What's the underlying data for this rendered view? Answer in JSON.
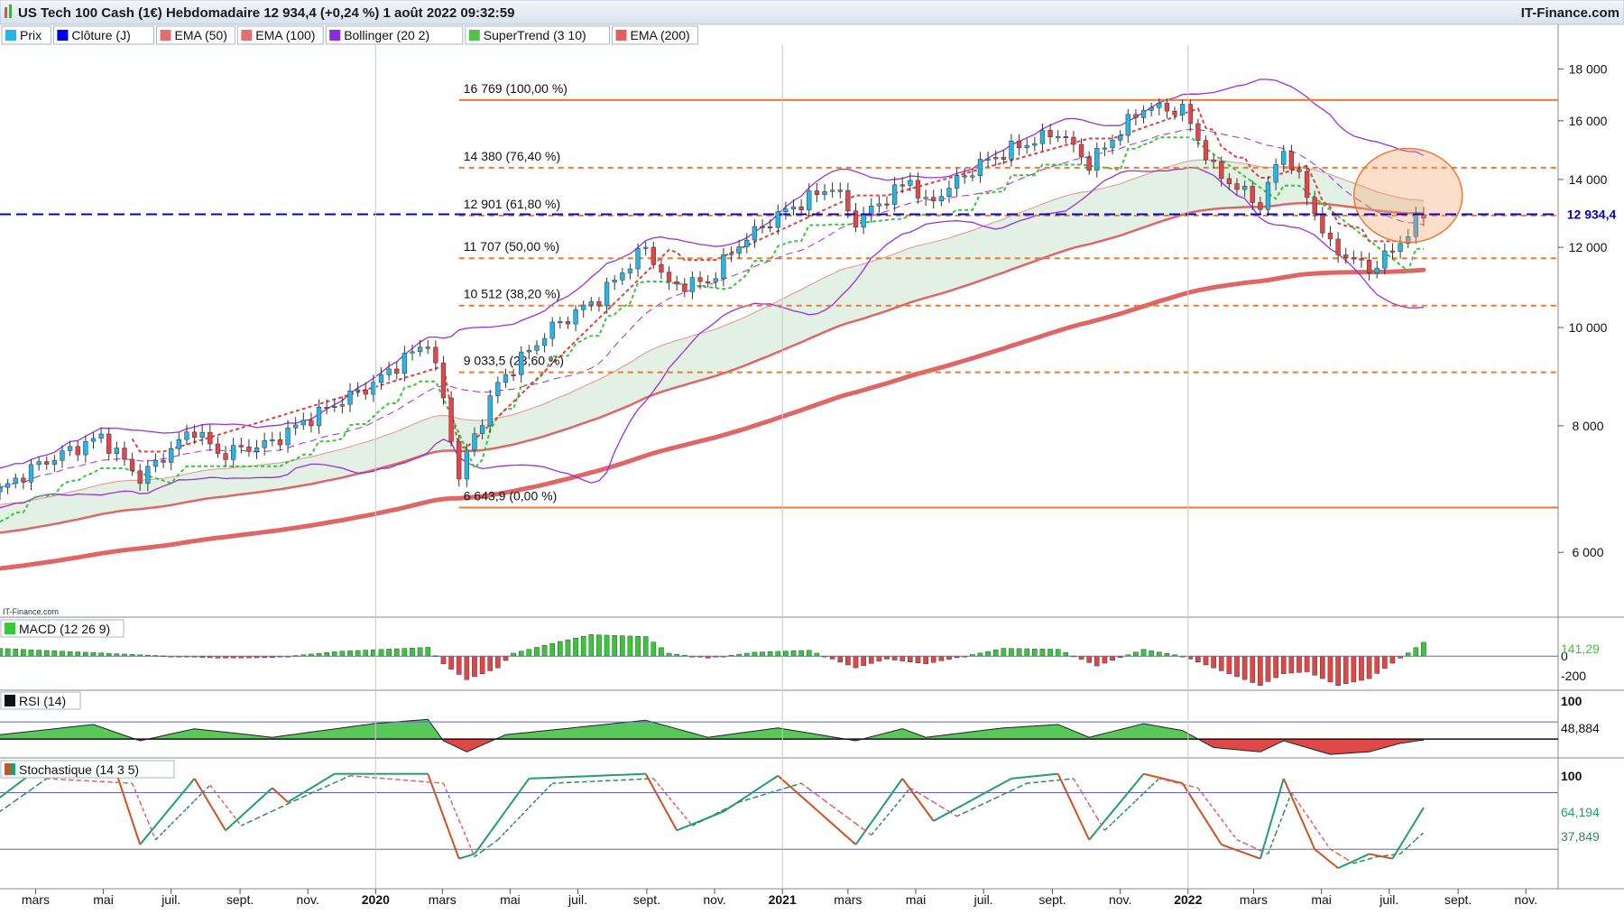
{
  "header": {
    "title": "US Tech 100 Cash (1€) Hebdomadaire 12 934,4 (+0,24 %) 1 août 2022 09:32:59",
    "brand": "IT-Finance.com"
  },
  "legend": [
    {
      "label": "Prix",
      "color": "#27b5e6"
    },
    {
      "label": "Clôture (J)",
      "color": "#0000ee"
    },
    {
      "label": "EMA (50)",
      "color": "#e07070"
    },
    {
      "label": "EMA (100)",
      "color": "#e07070"
    },
    {
      "label": "Bollinger (20 2)",
      "color": "#8a2be2"
    },
    {
      "label": "SuperTrend (3 10)",
      "color": "#4dc24d"
    },
    {
      "label": "EMA (200)",
      "color": "#e06060"
    }
  ],
  "watermark": "IT-Finance.com",
  "colors": {
    "up_candle": "#27b5e6",
    "down_candle": "#e0474c",
    "fib_line": "#f07830",
    "last_price_line": "#0000dd",
    "bollinger": "#9b30d9",
    "supertrend": "#3cc43c",
    "supertrend_down": "#e04040",
    "ema": "#e06666",
    "macd_pos": "#37c837",
    "macd_neg": "#e04646",
    "stoch_k": "#1f9e6e",
    "stoch_d": "#2e8b57"
  },
  "chart_data": [
    {
      "type": "candlestick",
      "panel": "price",
      "scale": "log",
      "ylim": [
        5200,
        19000
      ],
      "y_ticks": [
        6000,
        8000,
        10000,
        12000,
        14000,
        16000,
        18000
      ],
      "y_tick_labels": [
        "6 000",
        "8 000",
        "10 000",
        "12 000",
        "14 000",
        "16 000",
        "18 000"
      ],
      "x_range": [
        "2019-01-28",
        "2022-11-30"
      ],
      "x_tick_labels": [
        {
          "date": "2019-03-01",
          "label": "mars",
          "bold": false
        },
        {
          "date": "2019-05-01",
          "label": "mai",
          "bold": false
        },
        {
          "date": "2019-07-01",
          "label": "juil.",
          "bold": false
        },
        {
          "date": "2019-09-01",
          "label": "sept.",
          "bold": false
        },
        {
          "date": "2019-11-01",
          "label": "nov.",
          "bold": false
        },
        {
          "date": "2020-01-01",
          "label": "2020",
          "bold": true
        },
        {
          "date": "2020-03-01",
          "label": "mars",
          "bold": false
        },
        {
          "date": "2020-05-01",
          "label": "mai",
          "bold": false
        },
        {
          "date": "2020-07-01",
          "label": "juil.",
          "bold": false
        },
        {
          "date": "2020-09-01",
          "label": "sept.",
          "bold": false
        },
        {
          "date": "2020-11-01",
          "label": "nov.",
          "bold": false
        },
        {
          "date": "2021-01-01",
          "label": "2021",
          "bold": true
        },
        {
          "date": "2021-03-01",
          "label": "mars",
          "bold": false
        },
        {
          "date": "2021-05-01",
          "label": "mai",
          "bold": false
        },
        {
          "date": "2021-07-01",
          "label": "juil.",
          "bold": false
        },
        {
          "date": "2021-09-01",
          "label": "sept.",
          "bold": false
        },
        {
          "date": "2021-11-01",
          "label": "nov.",
          "bold": false
        },
        {
          "date": "2022-01-01",
          "label": "2022",
          "bold": true
        },
        {
          "date": "2022-03-01",
          "label": "mars",
          "bold": false
        },
        {
          "date": "2022-05-01",
          "label": "mai",
          "bold": false
        },
        {
          "date": "2022-07-01",
          "label": "juil.",
          "bold": false
        },
        {
          "date": "2022-09-01",
          "label": "sept.",
          "bold": false
        },
        {
          "date": "2022-11-01",
          "label": "nov.",
          "bold": false
        }
      ],
      "close_anchors": [
        [
          "2019-01-28",
          6900
        ],
        [
          "2019-03-01",
          7300
        ],
        [
          "2019-04-29",
          7800
        ],
        [
          "2019-06-03",
          7100
        ],
        [
          "2019-07-22",
          7950
        ],
        [
          "2019-08-12",
          7500
        ],
        [
          "2019-09-30",
          7700
        ],
        [
          "2019-10-14",
          7900
        ],
        [
          "2019-11-25",
          8400
        ],
        [
          "2019-12-30",
          8800
        ],
        [
          "2020-02-17",
          9700
        ],
        [
          "2020-03-02",
          8500
        ],
        [
          "2020-03-16",
          7100
        ],
        [
          "2020-03-23",
          7500
        ],
        [
          "2020-04-20",
          8800
        ],
        [
          "2020-06-08",
          10000
        ],
        [
          "2020-07-20",
          10700
        ],
        [
          "2020-08-31",
          12000
        ],
        [
          "2020-09-21",
          11000
        ],
        [
          "2020-10-26",
          11100
        ],
        [
          "2020-11-23",
          12100
        ],
        [
          "2020-12-28",
          12900
        ],
        [
          "2021-02-15",
          13800
        ],
        [
          "2021-03-08",
          12700
        ],
        [
          "2021-04-26",
          14000
        ],
        [
          "2021-05-10",
          13200
        ],
        [
          "2021-06-28",
          14500
        ],
        [
          "2021-07-26",
          15000
        ],
        [
          "2021-09-06",
          15600
        ],
        [
          "2021-10-04",
          14500
        ],
        [
          "2021-11-22",
          16500
        ],
        [
          "2021-12-27",
          16400
        ],
        [
          "2022-01-24",
          14300
        ],
        [
          "2022-03-07",
          13200
        ],
        [
          "2022-03-28",
          15000
        ],
        [
          "2022-05-09",
          12000
        ],
        [
          "2022-05-23",
          11800
        ],
        [
          "2022-06-13",
          11400
        ],
        [
          "2022-07-04",
          11900
        ],
        [
          "2022-08-01",
          12934.4
        ]
      ],
      "last_price": 12934.4,
      "last_price_label": "12 934,4",
      "fibonacci": [
        {
          "value": 16769,
          "label": "16 769 (100,00 %)",
          "solid": true
        },
        {
          "value": 14380,
          "label": "14 380 (76,40 %)",
          "solid": false
        },
        {
          "value": 12901,
          "label": "12 901 (61,80 %)",
          "solid": false
        },
        {
          "value": 11707,
          "label": "11 707 (50,00 %)",
          "solid": false
        },
        {
          "value": 10512,
          "label": "10 512 (38,20 %)",
          "solid": false
        },
        {
          "value": 9033.5,
          "label": "9 033,5 (23,60 %)",
          "solid": false
        },
        {
          "value": 6643.9,
          "label": "6 643,9 (0,00 %)",
          "solid": true
        }
      ],
      "fib_start": "2020-03-16",
      "highlight_circle": {
        "date": "2022-07-18",
        "value": 13500
      }
    },
    {
      "type": "histogram",
      "panel": "macd",
      "label": "MACD (12 26 9)",
      "ylim": [
        -330,
        380
      ],
      "ticks": [
        0,
        -200
      ],
      "tick_labels": [
        "0",
        "-200"
      ],
      "last_value_label": "141,29",
      "anchors": [
        [
          "2019-01-28",
          80
        ],
        [
          "2019-06-10",
          10
        ],
        [
          "2019-08-12",
          -20
        ],
        [
          "2019-10-01",
          -15
        ],
        [
          "2019-12-01",
          50
        ],
        [
          "2020-02-17",
          90
        ],
        [
          "2020-03-02",
          -80
        ],
        [
          "2020-03-23",
          -240
        ],
        [
          "2020-04-20",
          -120
        ],
        [
          "2020-05-04",
          30
        ],
        [
          "2020-06-15",
          150
        ],
        [
          "2020-07-13",
          220
        ],
        [
          "2020-08-31",
          200
        ],
        [
          "2020-09-21",
          30
        ],
        [
          "2020-10-26",
          -20
        ],
        [
          "2020-12-07",
          40
        ],
        [
          "2021-01-25",
          60
        ],
        [
          "2021-03-08",
          -120
        ],
        [
          "2021-04-05",
          -30
        ],
        [
          "2021-05-10",
          -80
        ],
        [
          "2021-06-14",
          0
        ],
        [
          "2021-07-19",
          80
        ],
        [
          "2021-09-06",
          70
        ],
        [
          "2021-10-11",
          -100
        ],
        [
          "2021-11-22",
          70
        ],
        [
          "2021-12-27",
          0
        ],
        [
          "2022-01-31",
          -150
        ],
        [
          "2022-03-07",
          -300
        ],
        [
          "2022-03-28",
          -180
        ],
        [
          "2022-04-18",
          -160
        ],
        [
          "2022-05-16",
          -300
        ],
        [
          "2022-06-13",
          -230
        ],
        [
          "2022-07-11",
          -20
        ],
        [
          "2022-08-01",
          141.29
        ]
      ]
    },
    {
      "type": "line",
      "panel": "rsi",
      "label": "RSI (14)",
      "ylim": [
        30,
        105
      ],
      "baseline": 50,
      "ticks": [
        100
      ],
      "tick_labels": [
        "100"
      ],
      "last_value_label": "48,884",
      "anchors": [
        [
          "2019-01-28",
          55
        ],
        [
          "2019-04-22",
          67
        ],
        [
          "2019-06-03",
          48
        ],
        [
          "2019-07-22",
          62
        ],
        [
          "2019-09-30",
          52
        ],
        [
          "2019-12-30",
          68
        ],
        [
          "2020-02-17",
          73
        ],
        [
          "2020-03-02",
          48
        ],
        [
          "2020-03-23",
          35
        ],
        [
          "2020-04-27",
          55
        ],
        [
          "2020-08-31",
          72
        ],
        [
          "2020-10-26",
          52
        ],
        [
          "2020-12-28",
          63
        ],
        [
          "2021-03-08",
          48
        ],
        [
          "2021-04-19",
          62
        ],
        [
          "2021-05-10",
          52
        ],
        [
          "2021-07-19",
          63
        ],
        [
          "2021-09-06",
          67
        ],
        [
          "2021-10-04",
          52
        ],
        [
          "2021-11-22",
          68
        ],
        [
          "2021-12-27",
          60
        ],
        [
          "2022-01-24",
          40
        ],
        [
          "2022-03-07",
          35
        ],
        [
          "2022-03-28",
          48
        ],
        [
          "2022-05-09",
          32
        ],
        [
          "2022-06-13",
          35
        ],
        [
          "2022-07-11",
          45
        ],
        [
          "2022-08-01",
          48.884
        ]
      ]
    },
    {
      "type": "line",
      "panel": "stochastic",
      "label": "Stochastique (14 3 5)",
      "ylim": [
        -20,
        115
      ],
      "ticks": [
        100
      ],
      "tick_labels": [
        "100"
      ],
      "band_levels": [
        80,
        20
      ],
      "k_last_label": "64,194",
      "d_last_label": "37,849",
      "k_anchors": [
        [
          "2019-01-28",
          75
        ],
        [
          "2019-02-25",
          100
        ],
        [
          "2019-05-13",
          100
        ],
        [
          "2019-06-03",
          25
        ],
        [
          "2019-07-22",
          95
        ],
        [
          "2019-08-19",
          40
        ],
        [
          "2019-09-30",
          85
        ],
        [
          "2019-10-14",
          70
        ],
        [
          "2019-11-25",
          100
        ],
        [
          "2020-02-17",
          100
        ],
        [
          "2020-03-16",
          10
        ],
        [
          "2020-03-30",
          15
        ],
        [
          "2020-05-18",
          95
        ],
        [
          "2020-08-31",
          100
        ],
        [
          "2020-09-28",
          40
        ],
        [
          "2020-11-09",
          60
        ],
        [
          "2020-12-28",
          98
        ],
        [
          "2021-03-08",
          25
        ],
        [
          "2021-04-19",
          95
        ],
        [
          "2021-05-17",
          50
        ],
        [
          "2021-07-26",
          95
        ],
        [
          "2021-09-06",
          100
        ],
        [
          "2021-10-04",
          30
        ],
        [
          "2021-11-22",
          100
        ],
        [
          "2021-12-27",
          90
        ],
        [
          "2022-01-31",
          25
        ],
        [
          "2022-03-07",
          10
        ],
        [
          "2022-03-28",
          95
        ],
        [
          "2022-04-25",
          20
        ],
        [
          "2022-05-16",
          0
        ],
        [
          "2022-06-13",
          15
        ],
        [
          "2022-07-04",
          10
        ],
        [
          "2022-08-01",
          64.194
        ]
      ],
      "d_anchors": [
        [
          "2019-01-28",
          60
        ],
        [
          "2019-03-11",
          95
        ],
        [
          "2019-05-27",
          90
        ],
        [
          "2019-06-17",
          30
        ],
        [
          "2019-08-05",
          88
        ],
        [
          "2019-09-02",
          45
        ],
        [
          "2019-10-21",
          72
        ],
        [
          "2019-12-09",
          98
        ],
        [
          "2020-03-02",
          90
        ],
        [
          "2020-03-30",
          12
        ],
        [
          "2020-04-20",
          30
        ],
        [
          "2020-06-08",
          90
        ],
        [
          "2020-09-07",
          95
        ],
        [
          "2020-10-12",
          45
        ],
        [
          "2020-11-23",
          70
        ],
        [
          "2021-01-18",
          90
        ],
        [
          "2021-03-22",
          35
        ],
        [
          "2021-04-26",
          85
        ],
        [
          "2021-06-07",
          55
        ],
        [
          "2021-08-09",
          90
        ],
        [
          "2021-09-20",
          95
        ],
        [
          "2021-10-18",
          40
        ],
        [
          "2021-12-06",
          95
        ],
        [
          "2022-01-10",
          85
        ],
        [
          "2022-02-14",
          30
        ],
        [
          "2022-03-14",
          15
        ],
        [
          "2022-04-04",
          80
        ],
        [
          "2022-05-09",
          20
        ],
        [
          "2022-05-30",
          5
        ],
        [
          "2022-06-20",
          12
        ],
        [
          "2022-07-11",
          15
        ],
        [
          "2022-08-01",
          37.849
        ]
      ]
    }
  ]
}
